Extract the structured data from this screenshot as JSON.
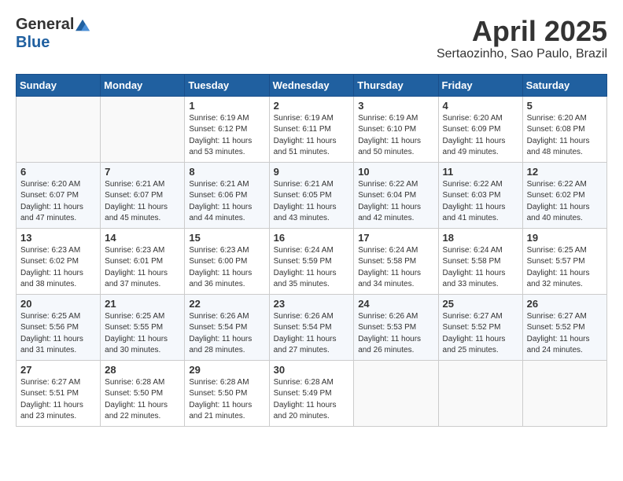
{
  "header": {
    "logo_general": "General",
    "logo_blue": "Blue",
    "month": "April 2025",
    "location": "Sertaozinho, Sao Paulo, Brazil"
  },
  "days_of_week": [
    "Sunday",
    "Monday",
    "Tuesday",
    "Wednesday",
    "Thursday",
    "Friday",
    "Saturday"
  ],
  "weeks": [
    [
      {
        "day": "",
        "info": ""
      },
      {
        "day": "",
        "info": ""
      },
      {
        "day": "1",
        "info": "Sunrise: 6:19 AM\nSunset: 6:12 PM\nDaylight: 11 hours and 53 minutes."
      },
      {
        "day": "2",
        "info": "Sunrise: 6:19 AM\nSunset: 6:11 PM\nDaylight: 11 hours and 51 minutes."
      },
      {
        "day": "3",
        "info": "Sunrise: 6:19 AM\nSunset: 6:10 PM\nDaylight: 11 hours and 50 minutes."
      },
      {
        "day": "4",
        "info": "Sunrise: 6:20 AM\nSunset: 6:09 PM\nDaylight: 11 hours and 49 minutes."
      },
      {
        "day": "5",
        "info": "Sunrise: 6:20 AM\nSunset: 6:08 PM\nDaylight: 11 hours and 48 minutes."
      }
    ],
    [
      {
        "day": "6",
        "info": "Sunrise: 6:20 AM\nSunset: 6:07 PM\nDaylight: 11 hours and 47 minutes."
      },
      {
        "day": "7",
        "info": "Sunrise: 6:21 AM\nSunset: 6:07 PM\nDaylight: 11 hours and 45 minutes."
      },
      {
        "day": "8",
        "info": "Sunrise: 6:21 AM\nSunset: 6:06 PM\nDaylight: 11 hours and 44 minutes."
      },
      {
        "day": "9",
        "info": "Sunrise: 6:21 AM\nSunset: 6:05 PM\nDaylight: 11 hours and 43 minutes."
      },
      {
        "day": "10",
        "info": "Sunrise: 6:22 AM\nSunset: 6:04 PM\nDaylight: 11 hours and 42 minutes."
      },
      {
        "day": "11",
        "info": "Sunrise: 6:22 AM\nSunset: 6:03 PM\nDaylight: 11 hours and 41 minutes."
      },
      {
        "day": "12",
        "info": "Sunrise: 6:22 AM\nSunset: 6:02 PM\nDaylight: 11 hours and 40 minutes."
      }
    ],
    [
      {
        "day": "13",
        "info": "Sunrise: 6:23 AM\nSunset: 6:02 PM\nDaylight: 11 hours and 38 minutes."
      },
      {
        "day": "14",
        "info": "Sunrise: 6:23 AM\nSunset: 6:01 PM\nDaylight: 11 hours and 37 minutes."
      },
      {
        "day": "15",
        "info": "Sunrise: 6:23 AM\nSunset: 6:00 PM\nDaylight: 11 hours and 36 minutes."
      },
      {
        "day": "16",
        "info": "Sunrise: 6:24 AM\nSunset: 5:59 PM\nDaylight: 11 hours and 35 minutes."
      },
      {
        "day": "17",
        "info": "Sunrise: 6:24 AM\nSunset: 5:58 PM\nDaylight: 11 hours and 34 minutes."
      },
      {
        "day": "18",
        "info": "Sunrise: 6:24 AM\nSunset: 5:58 PM\nDaylight: 11 hours and 33 minutes."
      },
      {
        "day": "19",
        "info": "Sunrise: 6:25 AM\nSunset: 5:57 PM\nDaylight: 11 hours and 32 minutes."
      }
    ],
    [
      {
        "day": "20",
        "info": "Sunrise: 6:25 AM\nSunset: 5:56 PM\nDaylight: 11 hours and 31 minutes."
      },
      {
        "day": "21",
        "info": "Sunrise: 6:25 AM\nSunset: 5:55 PM\nDaylight: 11 hours and 30 minutes."
      },
      {
        "day": "22",
        "info": "Sunrise: 6:26 AM\nSunset: 5:54 PM\nDaylight: 11 hours and 28 minutes."
      },
      {
        "day": "23",
        "info": "Sunrise: 6:26 AM\nSunset: 5:54 PM\nDaylight: 11 hours and 27 minutes."
      },
      {
        "day": "24",
        "info": "Sunrise: 6:26 AM\nSunset: 5:53 PM\nDaylight: 11 hours and 26 minutes."
      },
      {
        "day": "25",
        "info": "Sunrise: 6:27 AM\nSunset: 5:52 PM\nDaylight: 11 hours and 25 minutes."
      },
      {
        "day": "26",
        "info": "Sunrise: 6:27 AM\nSunset: 5:52 PM\nDaylight: 11 hours and 24 minutes."
      }
    ],
    [
      {
        "day": "27",
        "info": "Sunrise: 6:27 AM\nSunset: 5:51 PM\nDaylight: 11 hours and 23 minutes."
      },
      {
        "day": "28",
        "info": "Sunrise: 6:28 AM\nSunset: 5:50 PM\nDaylight: 11 hours and 22 minutes."
      },
      {
        "day": "29",
        "info": "Sunrise: 6:28 AM\nSunset: 5:50 PM\nDaylight: 11 hours and 21 minutes."
      },
      {
        "day": "30",
        "info": "Sunrise: 6:28 AM\nSunset: 5:49 PM\nDaylight: 11 hours and 20 minutes."
      },
      {
        "day": "",
        "info": ""
      },
      {
        "day": "",
        "info": ""
      },
      {
        "day": "",
        "info": ""
      }
    ]
  ]
}
